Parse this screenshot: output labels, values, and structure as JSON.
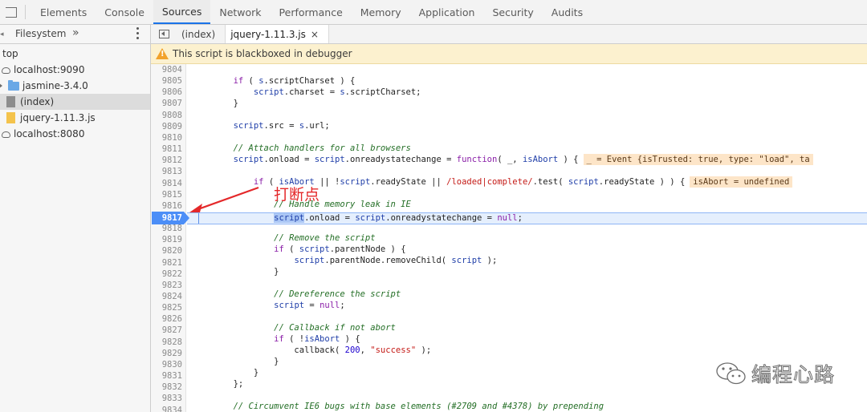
{
  "top_tabs": [
    "Elements",
    "Console",
    "Sources",
    "Network",
    "Performance",
    "Memory",
    "Application",
    "Security",
    "Audits"
  ],
  "active_top_tab": "Sources",
  "navigator": {
    "tab_label": "Filesystem",
    "more_symbol": "»",
    "tree": [
      {
        "label": "top",
        "icon": "none"
      },
      {
        "label": "localhost:9090",
        "icon": "cloud-icon"
      },
      {
        "label": "jasmine-3.4.0",
        "icon": "folder-icon"
      },
      {
        "label": "(index)",
        "icon": "file-icon",
        "selected": true
      },
      {
        "label": "jquery-1.11.3.js",
        "icon": "js-file-icon"
      },
      {
        "label": "localhost:8080",
        "icon": "cloud-icon"
      }
    ]
  },
  "editor": {
    "file_tabs": [
      {
        "label": "(index)",
        "active": false
      },
      {
        "label": "jquery-1.11.3.js",
        "active": true,
        "close": "×"
      }
    ],
    "warning": "This script is blackboxed in debugger",
    "line_numbers": [
      "9804",
      "9805",
      "9806",
      "9807",
      "9808",
      "9809",
      "9810",
      "9811",
      "9812",
      "9813",
      "9814",
      "9815",
      "9816",
      "9817",
      "9818",
      "9819",
      "9820",
      "9821",
      "9822",
      "9823",
      "9824",
      "9825",
      "9826",
      "9827",
      "9828",
      "9829",
      "9830",
      "9831",
      "9832",
      "9833",
      "9834"
    ],
    "breakpoint_line": "9817",
    "inline_values": {
      "line_9812": "_ = Event {isTrusted: true, type: \"load\", ta",
      "line_9814": "isAbort = undefined"
    }
  },
  "annotation": {
    "text": "打断点",
    "color": "#e4282a"
  },
  "watermark": {
    "text": "编程心路"
  },
  "colors": {
    "accent": "#1a73e8",
    "breakpoint": "#4c8ef7",
    "warning_bg": "#fcf1cf"
  }
}
